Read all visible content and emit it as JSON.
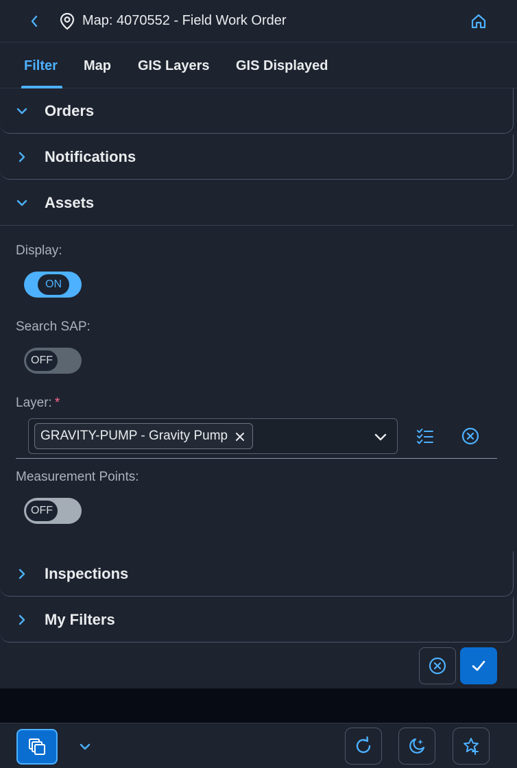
{
  "header": {
    "title": "Map: 4070552 - Field Work Order",
    "back_icon": "chevron-left-icon",
    "location_icon": "map-pin-icon",
    "home_icon": "home-icon"
  },
  "tabs": [
    {
      "label": "Filter",
      "active": true
    },
    {
      "label": "Map",
      "active": false
    },
    {
      "label": "GIS Layers",
      "active": false
    },
    {
      "label": "GIS Displayed",
      "active": false
    }
  ],
  "sections": {
    "orders": {
      "label": "Orders",
      "expanded": true
    },
    "notifications": {
      "label": "Notifications",
      "expanded": false
    },
    "assets": {
      "label": "Assets",
      "expanded": true
    },
    "inspections": {
      "label": "Inspections",
      "expanded": false
    },
    "my_filters": {
      "label": "My Filters",
      "expanded": false
    }
  },
  "assets_form": {
    "display": {
      "label": "Display:",
      "state": "ON",
      "on": true
    },
    "search_sap": {
      "label": "Search SAP:",
      "state": "OFF",
      "on": false
    },
    "layer": {
      "label": "Layer:",
      "required_marker": "*",
      "selected_token": "GRAVITY-PUMP - Gravity Pump",
      "select_all_icon": "checklist-icon",
      "clear_icon": "clear-circle-icon"
    },
    "measurement_points": {
      "label": "Measurement Points:",
      "state": "OFF",
      "on": false
    }
  },
  "footer_actions": {
    "reject_icon": "clear-circle-icon",
    "accept_icon": "checkmark-icon"
  },
  "bottom_bar": {
    "icons": [
      "window-stack-icon",
      "chevron-down-icon",
      "refresh-icon",
      "night-mode-icon",
      "favorite-add-icon"
    ]
  },
  "colors": {
    "accent": "#4db1ff",
    "primary_button": "#0a6ed1",
    "background": "#1d232f",
    "required": "#ff6a8f"
  }
}
